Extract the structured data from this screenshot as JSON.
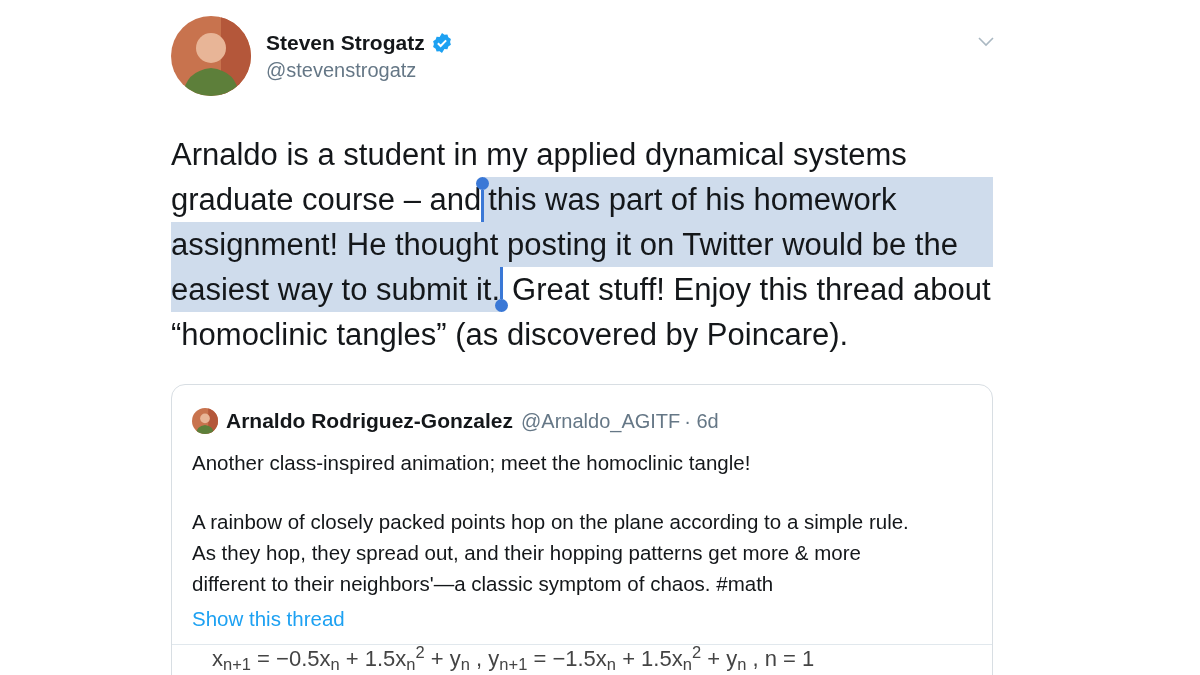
{
  "author": {
    "name": "Steven Strogatz",
    "verified": true,
    "handle": "@stevenstrogatz"
  },
  "tweet": {
    "lines": [
      {
        "segments": [
          {
            "text": "Arnaldo is a student in my applied dynamical systems",
            "selected": false
          }
        ]
      },
      {
        "segments": [
          {
            "text": "graduate course – and",
            "selected": false
          },
          {
            "kind": "handle",
            "at_end": false
          },
          {
            "text": "this was part of his homework",
            "selected": true
          }
        ]
      },
      {
        "segments": [
          {
            "text": "assignment! He thought posting it on Twitter would be the",
            "selected": true
          }
        ]
      },
      {
        "segments": [
          {
            "text": "easiest way to submit it.",
            "selected": true
          },
          {
            "kind": "handle",
            "at_end": true
          },
          {
            "text": "Great stuff! Enjoy this thread about",
            "selected": false
          }
        ]
      },
      {
        "segments": [
          {
            "text": "“homoclinic tangles” (as discovered by Poincare).",
            "selected": false
          }
        ]
      }
    ]
  },
  "quoted_tweet": {
    "name": "Arnaldo Rodriguez-Gonzalez",
    "handle": "@Arnaldo_AGITF",
    "time": "· 6d",
    "paragraphs": [
      "Another class-inspired animation; meet the homoclinic tangle!",
      "A rainbow of closely packed points hop on the plane according to a simple rule. As they hop, they spread out, and their hopping patterns get more & more different to their neighbors'—a classic symptom of chaos. #math"
    ],
    "link": "Show this thread",
    "formula": "x$_{n+1}$ = −0.5x$_{n}$ + 1.5x$_{n}$$^{2}$ + y$_{n}$ , y$_{n+1}$ = −1.5x$_{n}$ + 1.5x$_{n}$$^{2}$ + y$_{n}$ , n = 1"
  }
}
